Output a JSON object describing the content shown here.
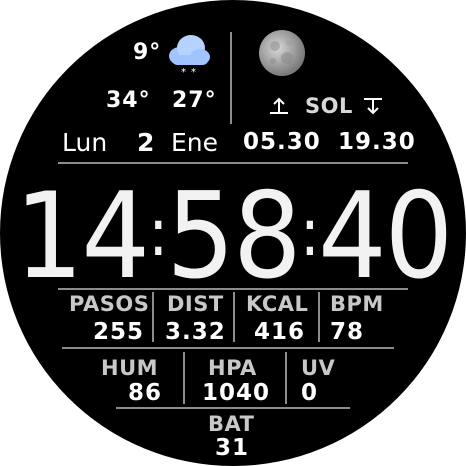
{
  "weather": {
    "current_temp": "9°",
    "high_temp": "34°",
    "low_temp": "27°",
    "condition_icon": "snow-cloud-icon"
  },
  "moon": {
    "icon": "moon-phase-icon"
  },
  "sun": {
    "label": "SOL",
    "sunrise_icon": "sunrise-arrow-icon",
    "sunset_icon": "sunset-arrow-icon"
  },
  "date": {
    "weekday": "Lun",
    "day": "2",
    "month": "Ene",
    "sunrise": "05.30",
    "sunset": "19.30"
  },
  "time": {
    "hours": "14",
    "minutes": "58",
    "seconds": "40",
    "separator": ":"
  },
  "stats_row1": [
    {
      "label": "PASOS",
      "value": "255"
    },
    {
      "label": "DIST",
      "value": "3.32"
    },
    {
      "label": "KCAL",
      "value": "416"
    },
    {
      "label": "BPM",
      "value": "78"
    }
  ],
  "stats_row2": [
    {
      "label": "HUM",
      "value": "86"
    },
    {
      "label": "HPA",
      "value": "1040"
    },
    {
      "label": "UV",
      "value": "0"
    }
  ],
  "battery": {
    "label": "BAT",
    "value": "31"
  },
  "colors": {
    "background": "#000000",
    "text": "#ffffff",
    "label": "#c8c8c8",
    "divider": "#8c8c8c",
    "cloud": "#9fc4ff"
  }
}
